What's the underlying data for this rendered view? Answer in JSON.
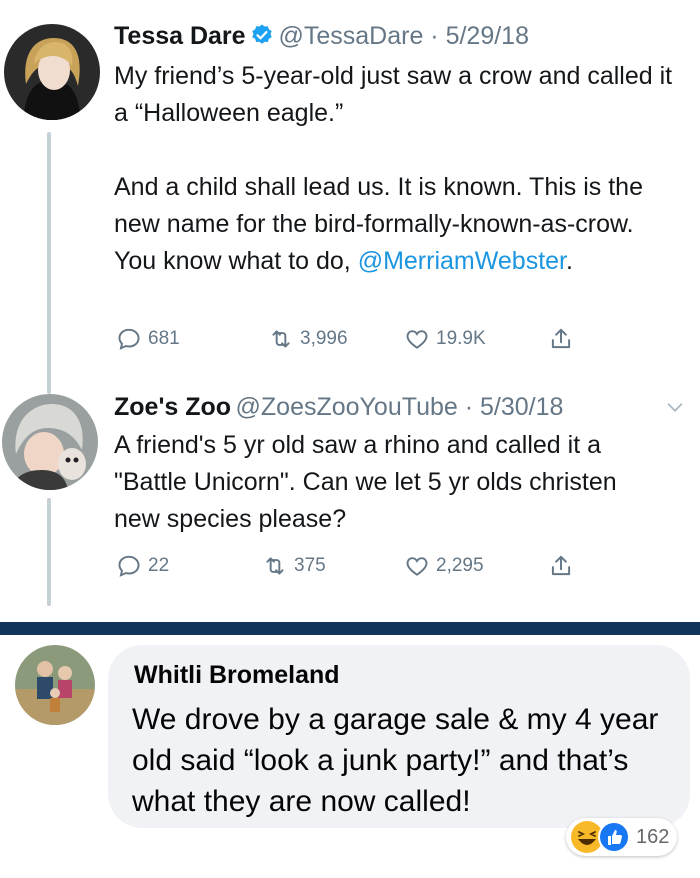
{
  "tweet1": {
    "name": "Tessa Dare",
    "handle_date": "@TessaDare · 5/29/18",
    "para1": "My friend’s 5-year-old just saw a crow and called it a “Halloween eagle.”",
    "para2": "And a child shall lead us. It is known. This is the new name for the bird-formally-known-as-crow. You know what to do,",
    "mention": "@MerriamWebster",
    "mention_tail": ".",
    "replies": "681",
    "retweets": "3,996",
    "likes": "19.9K"
  },
  "tweet2": {
    "name": "Zoe's Zoo",
    "handle_date": "@ZoesZooYouTube · 5/30/18",
    "text": "A friend's 5 yr old saw a rhino and called it a \"Battle Unicorn\". Can we let 5 yr olds christen new species please?",
    "replies": "22",
    "retweets": "375",
    "likes": "2,295"
  },
  "comment": {
    "name": "Whitli Bromeland",
    "text": "We drove by a garage sale & my 4 year old said “look a junk party!” and that’s what they are now called!",
    "reaction_count": "162"
  },
  "colors": {
    "accent": "#1b95e0",
    "divider": "#12335a",
    "bubble": "#f0f2f5"
  }
}
